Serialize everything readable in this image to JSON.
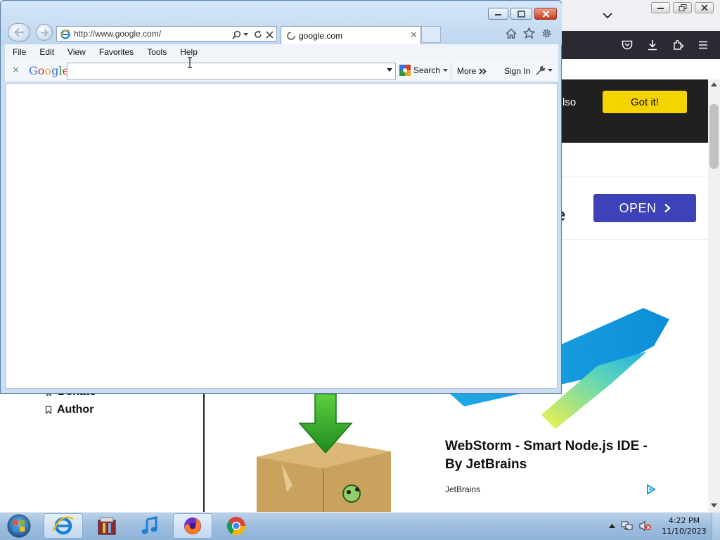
{
  "background_page": {
    "banner_text": "lso",
    "got_it_label": "Got it!",
    "ad_partial_text": "e",
    "open_label": "OPEN",
    "side_links": [
      {
        "label": "Donate",
        "icon": "star-icon"
      },
      {
        "label": "Author",
        "icon": "bookmark-icon"
      }
    ],
    "ad_title": "WebStorm - Smart Node.js IDE - By JetBrains",
    "ad_advertiser": "JetBrains"
  },
  "ie": {
    "address": "http://www.google.com/",
    "tab_label": "google.com",
    "menu": [
      "File",
      "Edit",
      "View",
      "Favorites",
      "Tools",
      "Help"
    ],
    "toolbar": {
      "logo": "Google",
      "search_value": "",
      "search_label": "Search",
      "more_label": "More",
      "signin_label": "Sign In"
    }
  },
  "taskbar": {
    "items": [
      "Internet Explorer",
      "Archive Manager",
      "iTunes",
      "Firefox",
      "Chrome"
    ],
    "time": "4:22 PM",
    "date": "11/10/2023"
  },
  "colors": {
    "got_it": "#f5d300",
    "open_button": "#3d42b9",
    "ie_frame": "#c9ddf3"
  }
}
